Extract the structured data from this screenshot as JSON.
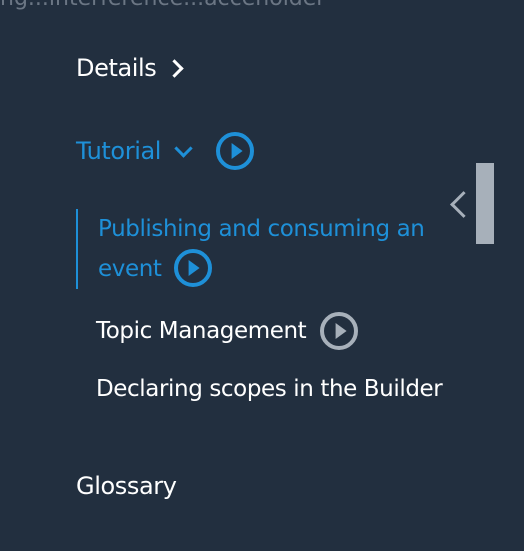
{
  "top_text": "ng...interference...acceholder",
  "nav": {
    "details": "Details",
    "tutorial": "Tutorial",
    "publishing": "Publishing and consuming an event",
    "topic_management": "Topic Management",
    "declaring_scopes": "Declaring scopes in the Builder",
    "glossary": "Glossary"
  },
  "colors": {
    "background": "#222f3f",
    "accent": "#1e90d8",
    "muted": "#a7b0ba",
    "text": "#ffffff"
  }
}
